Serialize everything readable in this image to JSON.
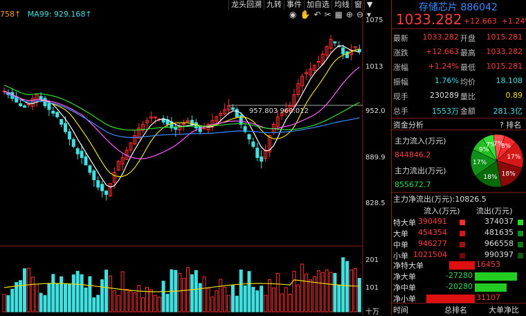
{
  "chart": {
    "ma_legend": [
      {
        "text": "758↑",
        "color": "#ff9f00"
      },
      {
        "text": "MA99: 929.168↑",
        "color": "#3ce0e0"
      }
    ],
    "top_buttons": [
      "龙头回溯",
      "九转",
      "事件",
      "加自选",
      "均线",
      "窗"
    ],
    "icons": [
      "eye-icon",
      "hand-icon",
      "undo-icon",
      "scissors-icon",
      "grid-icon",
      "zoom-in-icon",
      "zoom-out-icon",
      "dropdown-icon"
    ],
    "y_labels": [
      "1075",
      "1013",
      "952.0",
      "889.9",
      "828.5"
    ],
    "vol_labels": [
      "201",
      "101"
    ],
    "vol_unit": "十万",
    "price_marker": "957.803",
    "price_marker2": "960.012"
  },
  "header": {
    "name": "存储芯片",
    "code": "886042",
    "price": "1033.282",
    "change": "+12.663",
    "change_pct": "+1.24%"
  },
  "quote": [
    {
      "l": "最新",
      "v": "1033.282",
      "vc": "red",
      "l2": "开盘",
      "v2": "1015.281",
      "v2c": "red"
    },
    {
      "l": "涨跌",
      "v": "+12.663",
      "vc": "red",
      "l2": "最高",
      "v2": "1033.282",
      "v2c": "red"
    },
    {
      "l": "涨幅",
      "v": "+1.24%",
      "vc": "red",
      "l2": "最低",
      "v2": "1015.281",
      "v2c": "red"
    },
    {
      "l": "振幅",
      "v": "1.76%",
      "vc": "cyan",
      "l2": "均价",
      "v2": "18.108",
      "v2c": "cyan"
    },
    {
      "l": "现手",
      "v": "230289",
      "vc": "white",
      "l2": "量比",
      "v2": "0.89",
      "v2c": "yellow"
    },
    {
      "l": "总手",
      "v": "1553万",
      "vc": "cyan",
      "l2": "金额",
      "v2": "281.3亿",
      "v2c": "cyan"
    }
  ],
  "fund": {
    "section_title": "资金分析",
    "tab_label": "排名",
    "inflow_label": "主力流入(万元)",
    "inflow_value": "844846.2",
    "outflow_label": "主力流出(万元)",
    "outflow_value": "855672.7",
    "net_label": "主力净流出(万元):",
    "net_value": "10826.5",
    "pie": [
      {
        "label": "8%",
        "value": 8,
        "color": "#ff2a2a"
      },
      {
        "label": "17%",
        "value": 17,
        "color": "#d41818"
      },
      {
        "label": "18%",
        "value": 18,
        "color": "#8a0a0a"
      },
      {
        "label": "18%",
        "value": 18,
        "color": "#0a6a0a"
      },
      {
        "label": "17%",
        "value": 17,
        "color": "#10901a"
      },
      {
        "label": "9%",
        "value": 9,
        "color": "#22c022"
      },
      {
        "label": "7%",
        "value": 7,
        "color": "#33dd33"
      },
      {
        "label": "7%",
        "value": 7,
        "color": "#ff5050"
      }
    ],
    "flow_header_in": "流入(万元)",
    "flow_header_out": "流出(万元)",
    "flow_rows": [
      {
        "label": "特大单",
        "in": "390491",
        "out": "374037",
        "incolor": "#ff2a2a",
        "outcolor": "#22dd22"
      },
      {
        "label": "大单",
        "in": "454354",
        "out": "481635",
        "incolor": "#d41818",
        "outcolor": "#10901a"
      },
      {
        "label": "中单",
        "in": "946277",
        "out": "966558",
        "incolor": "#a01010",
        "outcolor": "#0a7a0a"
      },
      {
        "label": "小单",
        "in": "1021504",
        "out": "990397",
        "incolor": "#700808",
        "outcolor": "#0a5a0a"
      }
    ],
    "net_rows": [
      {
        "label": "净特大单",
        "value": "16453",
        "sign": 1,
        "magnitude": 16453,
        "color": "#ff3b3b"
      },
      {
        "label": "净大单",
        "value": "-27280",
        "sign": -1,
        "magnitude": 27280,
        "color": "#22dd22"
      },
      {
        "label": "净中单",
        "value": "-20280",
        "sign": -1,
        "magnitude": 20280,
        "color": "#22dd22"
      },
      {
        "label": "净小单",
        "value": "31107",
        "sign": 1,
        "magnitude": 31107,
        "color": "#ff3b3b"
      }
    ],
    "footer_left": "时间",
    "footer_mid": "总排名",
    "footer_right": "大单净比"
  }
}
